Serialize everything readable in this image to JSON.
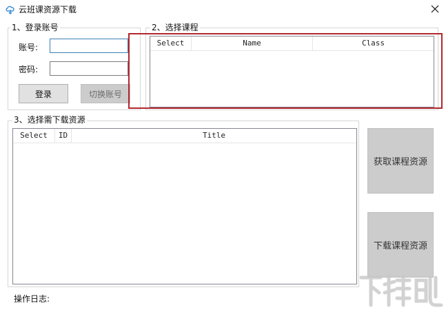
{
  "window": {
    "title": "云班课资源下载",
    "close_glyph": "✕"
  },
  "login": {
    "group_title": "1、登录账号",
    "account_label": "账号:",
    "account_value": "",
    "password_label": "密码:",
    "password_value": "",
    "login_button": "登录",
    "switch_button": "切换账号"
  },
  "courses": {
    "group_title": "2、选择课程",
    "columns": [
      "Select",
      "Name",
      "Class"
    ]
  },
  "resources": {
    "group_title": "3、选择需下载资源",
    "columns": [
      "Select",
      "ID",
      "Title"
    ]
  },
  "actions": {
    "fetch_button": "获取课程资源",
    "download_button": "下载课程资源"
  },
  "log": {
    "label": "操作日志:"
  },
  "colors": {
    "highlight": "#b3262c"
  },
  "watermark": {
    "text": "下载吧"
  }
}
